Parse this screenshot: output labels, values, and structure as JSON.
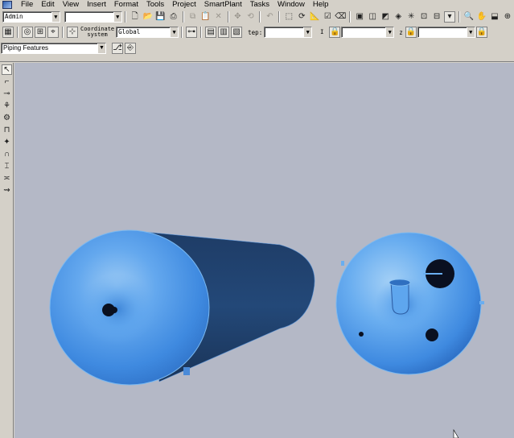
{
  "menu": {
    "items": [
      "File",
      "Edit",
      "View",
      "Insert",
      "Format",
      "Tools",
      "Project",
      "SmartPlant",
      "Tasks",
      "Window",
      "Help"
    ]
  },
  "toolbar1": {
    "user_combo": "Admin",
    "filter_combo": ""
  },
  "toolbar2": {
    "coordinate_label_line1": "Coordinate",
    "coordinate_label_line2": "system",
    "coordinate_combo": "Global",
    "step_label": "tep:",
    "step_combo": "",
    "right_combo_1": "",
    "z_label": "z",
    "right_combo_2": ""
  },
  "toolbar3": {
    "task_combo": "Piping Features"
  },
  "icons": {
    "toolbar1": [
      "new-icon",
      "open-icon",
      "save-icon",
      "print-icon",
      "copy-icon",
      "paste-icon",
      "delete-icon",
      "move-icon",
      "rotate-icon",
      "undo-icon",
      "select-icon",
      "refresh-icon",
      "measure-icon",
      "properties-icon",
      "eraser-icon",
      "view-front-icon",
      "view-top-icon",
      "view-right-icon",
      "view-iso-icon",
      "view-rotate-icon",
      "fit-icon",
      "clip-icon",
      "layers-icon",
      "zoom-icon",
      "pan-icon"
    ],
    "left_tools": [
      "pointer-icon",
      "route-pipe-icon",
      "insert-component-icon",
      "insert-instrument-icon",
      "insert-specialty-icon",
      "insert-tap-icon",
      "insert-support-icon",
      "insert-bend-icon",
      "insert-feature-icon",
      "split-icon",
      "connect-icon"
    ]
  },
  "colors": {
    "viewport_bg": "#b4b8c6",
    "vessel_light": "#9ccaf4",
    "vessel_mid": "#3f8ae0",
    "vessel_dark": "#1e3c66",
    "nozzle_dark": "#0a1020"
  }
}
